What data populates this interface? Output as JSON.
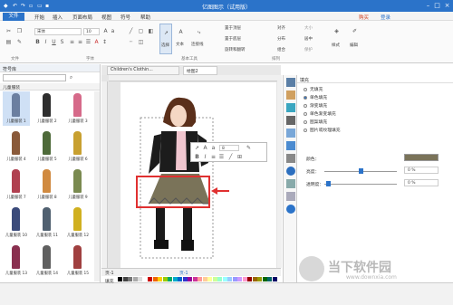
{
  "title": {
    "text": "亿图图示（试用版）"
  },
  "menu": {
    "file": "文件",
    "items": [
      "开始",
      "插入",
      "页面布局",
      "视图",
      "符号",
      "帮助"
    ],
    "right": [
      "购买",
      "登录"
    ]
  },
  "ribbon": {
    "font_name": "宋体",
    "font_size": "10",
    "groups": [
      "文件",
      "字体",
      "基本工具",
      "排列"
    ],
    "tools": {
      "select": "选择",
      "text": "文本",
      "connector": "连接线"
    },
    "arrange": [
      "置于顶层",
      "置于底层",
      "旋转和翻转",
      "对齐",
      "分布",
      "组合",
      "大小",
      "居中",
      "保护"
    ],
    "style": "样式",
    "edit": "编辑"
  },
  "left_panel": {
    "title": "符号库",
    "category": "儿童服装",
    "items": [
      "儿童服装 1",
      "儿童服装 2",
      "儿童服装 3",
      "儿童服装 4",
      "儿童服装 5",
      "儿童服装 6",
      "儿童服装 7",
      "儿童服装 8",
      "儿童服装 9",
      "儿童服装 10",
      "儿童服装 11",
      "儿童服装 12",
      "儿童服装 13",
      "儿童服装 14",
      "儿童服装 15"
    ],
    "bottom_tabs": [
      "符号库",
      "文件恢复"
    ]
  },
  "tabs": [
    "Children's Clothin...",
    "绘图2"
  ],
  "float_toolbar": {
    "font_size": "8"
  },
  "bottom": {
    "page_label": "页-1",
    "page_tab": "页-1"
  },
  "status": {
    "fill_label": "填充"
  },
  "fill_panel": {
    "title": "填充",
    "options": [
      "无填充",
      "单色填充",
      "渐变填充",
      "单色渐变填充",
      "图案填充",
      "图片或纹理填充"
    ],
    "color_label": "颜色：",
    "brightness_label": "亮度：",
    "brightness_value": "0 %",
    "transparency_label": "透明度：",
    "transparency_value": "0 %"
  },
  "watermark": {
    "cn": "当下软件园",
    "url": "www.downxia.com"
  },
  "colors": {
    "accent": "#2b73c9",
    "selection": "#e03030",
    "dress": "#7a7359"
  }
}
